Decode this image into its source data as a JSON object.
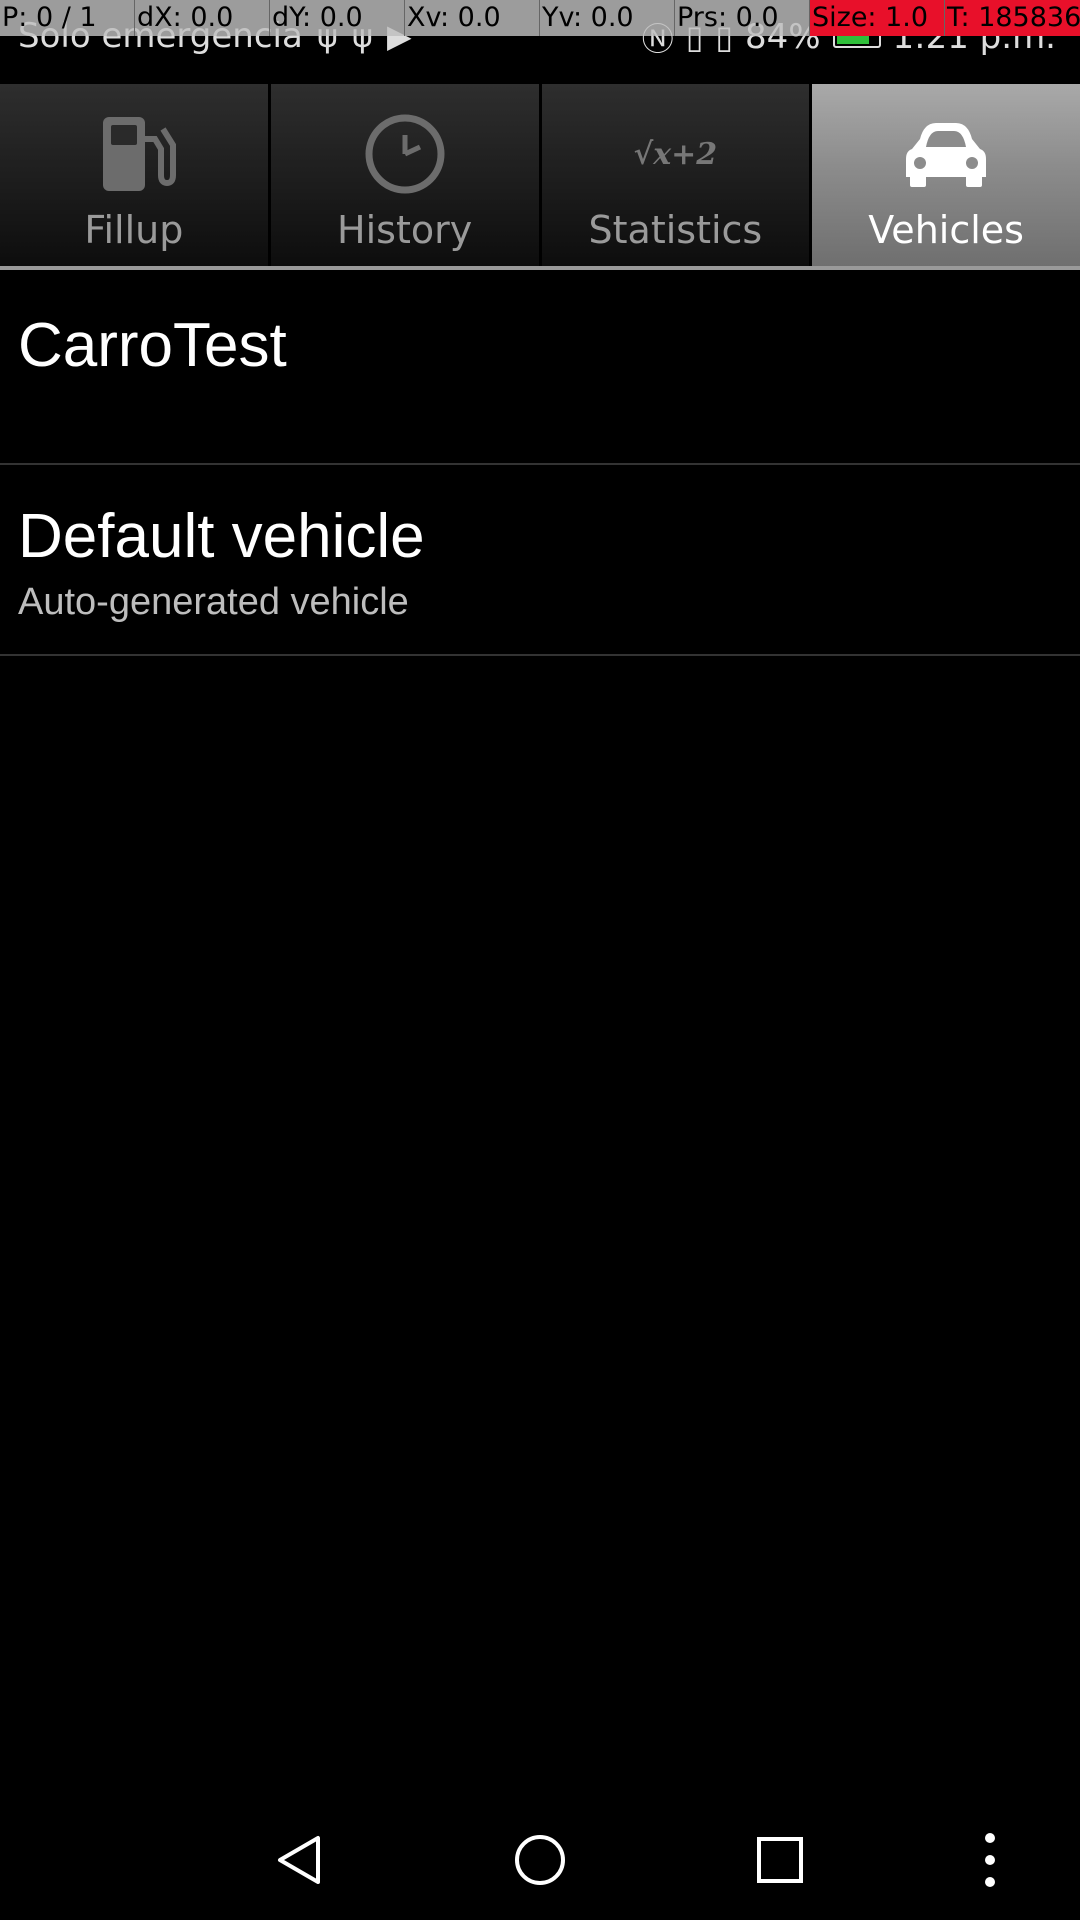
{
  "debug_overlay": {
    "pointer": "P: 0 / 1",
    "dx": "dX: 0.0",
    "dy": "dY: 0.0",
    "xv": "Xv: 0.0",
    "yv": "Yv: 0.0",
    "prs": "Prs: 0.0",
    "size": "Size: 1.0",
    "t": "T: 185836"
  },
  "status_bar": {
    "carrier": "Solo emergencia",
    "battery_percent": "84%",
    "battery_level": 0.84,
    "time": "1:21 p.m."
  },
  "tabs": [
    {
      "label": "Fillup",
      "icon": "fuel-pump-icon",
      "active": false
    },
    {
      "label": "History",
      "icon": "clock-icon",
      "active": false
    },
    {
      "label": "Statistics",
      "icon": "sqrt-formula-icon",
      "icon_text": "√x+2",
      "active": false
    },
    {
      "label": "Vehicles",
      "icon": "car-icon",
      "active": true
    }
  ],
  "vehicles": [
    {
      "name": "CarroTest",
      "description": ""
    },
    {
      "name": "Default vehicle",
      "description": "Auto-generated vehicle"
    }
  ],
  "colors": {
    "background": "#000000",
    "active_tab": "#8c8c8c",
    "battery": "#2fbf3a",
    "debug_highlight": "#e8102a"
  }
}
